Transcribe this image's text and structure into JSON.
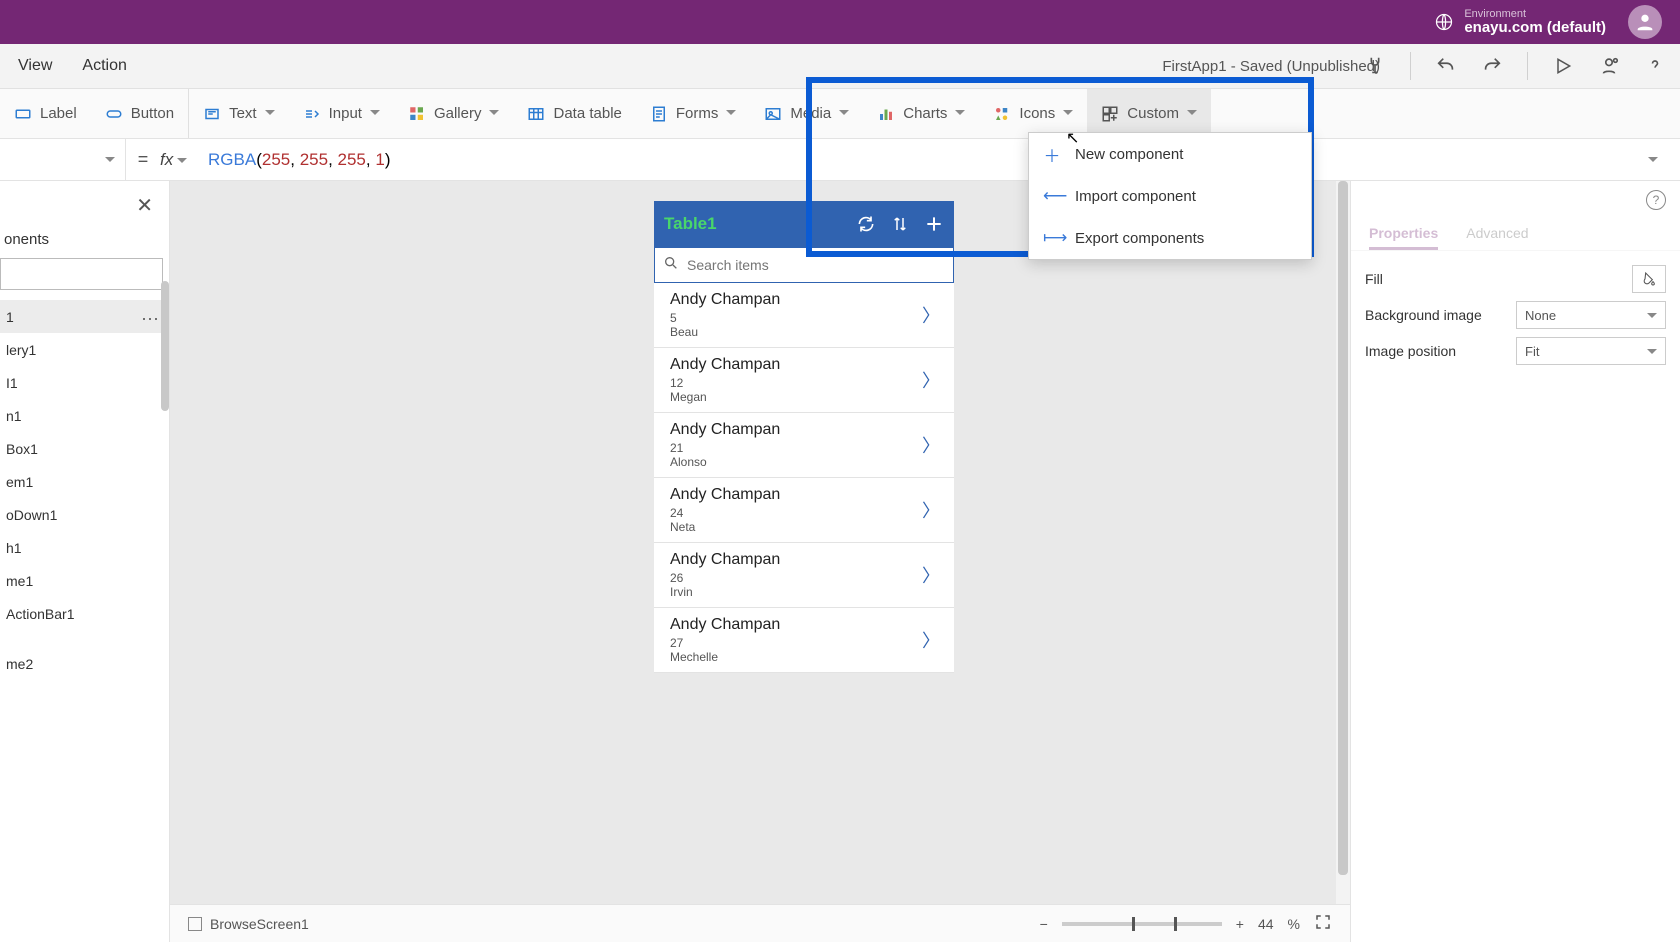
{
  "titlebar": {
    "env_label": "Environment",
    "env_value": "enayu.com (default)"
  },
  "menubar": {
    "items": [
      "View",
      "Action"
    ],
    "app_status": "FirstApp1 - Saved (Unpublished)"
  },
  "ribbon": {
    "label": "Label",
    "button": "Button",
    "text": "Text",
    "input": "Input",
    "gallery": "Gallery",
    "datatable": "Data table",
    "forms": "Forms",
    "media": "Media",
    "charts": "Charts",
    "icons": "Icons",
    "custom": "Custom"
  },
  "formula": {
    "eq": "=",
    "fx": "fx",
    "fn": "RGBA",
    "open": "(",
    "a1": "255",
    "c": ", ",
    "a2": "255",
    "a3": "255",
    "a4": "1",
    "close": ")"
  },
  "leftpanel": {
    "tab": "onents",
    "nodes": [
      "1",
      "lery1",
      "I1",
      "n1",
      "Box1",
      "em1",
      "oDown1",
      "h1",
      "me1",
      "ActionBar1",
      "",
      "me2"
    ]
  },
  "phone": {
    "title": "Table1",
    "search_placeholder": "Search items",
    "items": [
      {
        "title": "Andy Champan",
        "sub1": "5",
        "sub2": "Beau"
      },
      {
        "title": "Andy Champan",
        "sub1": "12",
        "sub2": "Megan"
      },
      {
        "title": "Andy Champan",
        "sub1": "21",
        "sub2": "Alonso"
      },
      {
        "title": "Andy Champan",
        "sub1": "24",
        "sub2": "Neta"
      },
      {
        "title": "Andy Champan",
        "sub1": "26",
        "sub2": "Irvin"
      },
      {
        "title": "Andy Champan",
        "sub1": "27",
        "sub2": "Mechelle"
      }
    ]
  },
  "dropdown": {
    "new": "New component",
    "import": "Import component",
    "export": "Export components"
  },
  "rightpanel": {
    "tab_properties": "Properties",
    "tab_advanced": "Advanced",
    "fill": "Fill",
    "bgimage": "Background image",
    "bgimage_val": "None",
    "imgpos": "Image position",
    "imgpos_val": "Fit"
  },
  "statusbar": {
    "screen": "BrowseScreen1",
    "zoom": "44",
    "pct": "%"
  }
}
